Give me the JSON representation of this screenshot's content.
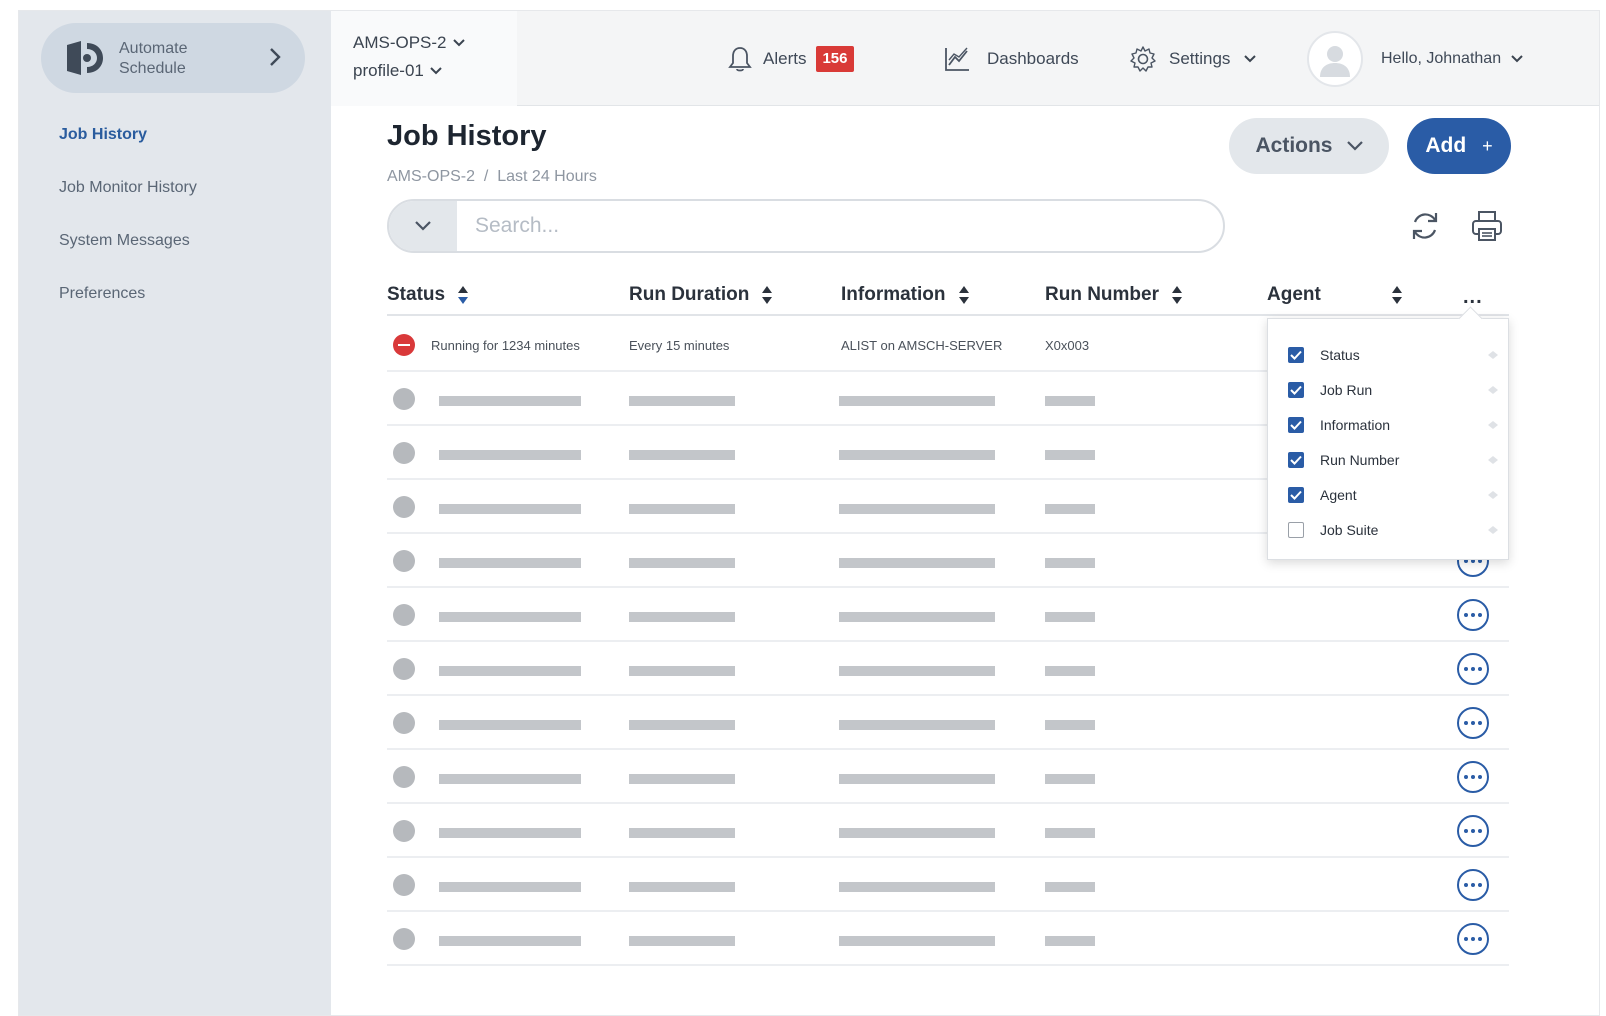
{
  "app": {
    "name_line1": "Automate",
    "name_line2": "Schedule"
  },
  "sidebar": {
    "items": [
      {
        "label": "Job History",
        "active": true
      },
      {
        "label": "Job Monitor History",
        "active": false
      },
      {
        "label": "System Messages",
        "active": false
      },
      {
        "label": "Preferences",
        "active": false
      }
    ]
  },
  "topbar": {
    "server": "AMS-OPS-2",
    "profile": "profile-01",
    "alerts_label": "Alerts",
    "alerts_count": "156",
    "dashboards_label": "Dashboards",
    "settings_label": "Settings",
    "user_greeting": "Hello, Johnathan"
  },
  "page": {
    "title": "Job History",
    "breadcrumb": "AMS-OPS-2  /  Last 24 Hours",
    "actions_label": "Actions",
    "add_label": "Add",
    "add_symbol": "+"
  },
  "search": {
    "placeholder": "Search..."
  },
  "table": {
    "columns": [
      "Status",
      "Run Duration",
      "Information",
      "Run Number",
      "Agent"
    ],
    "more_label": "...",
    "first_row": {
      "status_text": "Running for 1234 minutes",
      "run_duration": "Every 15 minutes",
      "information": "ALIST on AMSCH-SERVER",
      "run_number": "X0x003"
    },
    "placeholder_rows": 11
  },
  "column_chooser": {
    "options": [
      {
        "label": "Status",
        "checked": true
      },
      {
        "label": "Job Run",
        "checked": true
      },
      {
        "label": "Information",
        "checked": true
      },
      {
        "label": "Run Number",
        "checked": true
      },
      {
        "label": "Agent",
        "checked": true
      },
      {
        "label": "Job Suite",
        "checked": false
      }
    ]
  },
  "colors": {
    "accent": "#2a5ca6",
    "error": "#d9393a",
    "badge": "#d93a37",
    "sidebar_bg": "#e3e7ec"
  }
}
